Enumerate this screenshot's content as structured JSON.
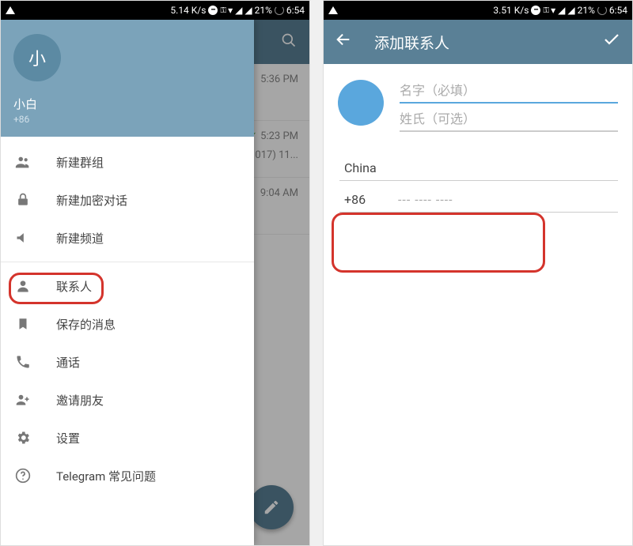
{
  "status": {
    "left_speed_a": "5.14 K/s",
    "left_speed_b": "3.51 K/s",
    "battery": "21%",
    "time": "6:54"
  },
  "left": {
    "avatar_letter": "小",
    "user_name": "小白",
    "user_phone": "+86",
    "chat_times": [
      "5:36 PM",
      "5:23 PM",
      "9:04 AM"
    ],
    "chat_sub": "017) 11...",
    "check": "✓",
    "drawer": {
      "new_group": "新建群组",
      "new_secret": "新建加密对话",
      "new_channel": "新建频道",
      "contacts": "联系人",
      "saved": "保存的消息",
      "calls": "通话",
      "invite": "邀请朋友",
      "settings": "设置",
      "faq": "Telegram 常见问题"
    }
  },
  "right": {
    "title": "添加联系人",
    "first_name_ph": "名字（必填）",
    "last_name_ph": "姓氏（可选）",
    "country": "China",
    "code": "+86",
    "phone_ph": "--- ---- ----"
  }
}
